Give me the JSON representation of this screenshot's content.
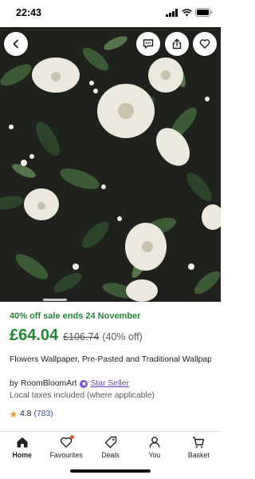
{
  "status_bar": {
    "time": "22:43"
  },
  "listing": {
    "sale_text": "40% off sale ends 24 November",
    "price": "£64.04",
    "original_price": "£106.74",
    "discount": "(40% off)",
    "title": "Flowers Wallpaper, Pre-Pasted and Traditional Wallpaper, Removable and Renter friendly Wall D...",
    "seller_by": "by",
    "seller_name": "RoomBloomArt",
    "star_seller_label": "Star Seller",
    "taxes_note": "Local taxes included (where applicable)",
    "rating": "4.8",
    "review_count": "(783)",
    "image_carousel_position": 0.2
  },
  "tabs": [
    {
      "label": "Home",
      "icon": "home-icon",
      "active": true
    },
    {
      "label": "Favourites",
      "icon": "heart-icon",
      "active": false,
      "has_notification": true
    },
    {
      "label": "Deals",
      "icon": "tag-icon",
      "active": false
    },
    {
      "label": "You",
      "icon": "person-icon",
      "active": false
    },
    {
      "label": "Basket",
      "icon": "basket-icon",
      "active": false
    }
  ],
  "colors": {
    "sale_green": "#258635",
    "star_seller_purple": "#6a3fbe",
    "review_link_blue": "#3a53a4",
    "rating_star": "#e8a03a",
    "notification_dot": "#e0632b"
  }
}
